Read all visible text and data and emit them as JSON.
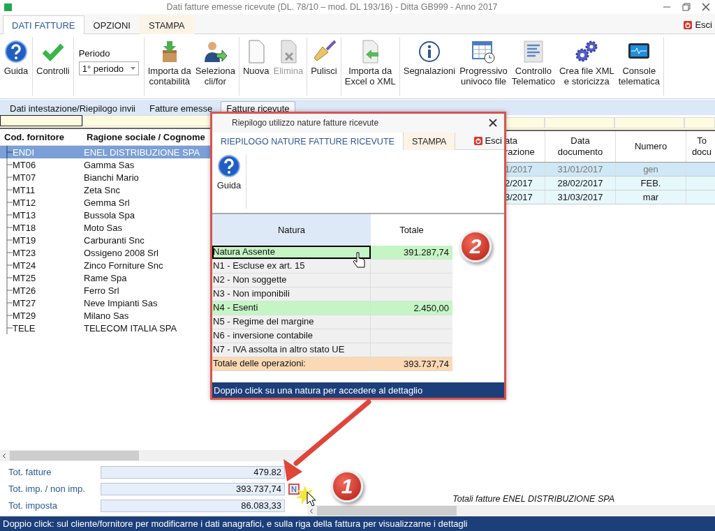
{
  "window": {
    "title": "Dati fatture emesse ricevute (DL. 78/10 – mod. DL 193/16) - Ditta GB999 - Anno 2017"
  },
  "ribbon": {
    "tabs": [
      {
        "label": "DATI FATTURE",
        "selected": true
      },
      {
        "label": "OPZIONI",
        "selected": false
      },
      {
        "label": "STAMPA",
        "selected": false
      }
    ],
    "exit": "Esci"
  },
  "toolbar": [
    [
      {
        "kind": "button",
        "label": "Guida",
        "disabled": false
      }
    ],
    [
      {
        "kind": "button",
        "label": "Controlli",
        "disabled": false
      }
    ],
    [
      {
        "kind": "select",
        "label": "Periodo",
        "value": "1° periodo"
      }
    ],
    [
      {
        "kind": "button",
        "label": "Importa da\ncontabilità",
        "disabled": false
      },
      {
        "kind": "button",
        "label": "Seleziona\ncli/for",
        "disabled": false
      }
    ],
    [
      {
        "kind": "button",
        "label": "Nuova",
        "disabled": false
      },
      {
        "kind": "button",
        "label": "Elimina",
        "disabled": true
      }
    ],
    [
      {
        "kind": "button",
        "label": "Pulisci",
        "disabled": false
      }
    ],
    [
      {
        "kind": "button",
        "label": "Importa da\nExcel o XML",
        "disabled": false
      }
    ],
    [
      {
        "kind": "button",
        "label": "Segnalazioni",
        "disabled": false
      },
      {
        "kind": "button",
        "label": "Progressivo\nunivoco file",
        "disabled": false
      },
      {
        "kind": "button",
        "label": "Controllo\nTelematico",
        "disabled": false
      },
      {
        "kind": "button",
        "label": "Crea file XML\ne storicizza",
        "disabled": false
      },
      {
        "kind": "button",
        "label": "Console\ntelematica",
        "disabled": false
      }
    ]
  ],
  "subtabs": [
    {
      "label": "Dati intestazione/Riepilogo invii",
      "selected": false
    },
    {
      "label": "Fatture emesse",
      "selected": false
    },
    {
      "label": "Fatture ricevute",
      "selected": true
    }
  ],
  "suppliers": {
    "columns": [
      "Cod. fornitore",
      "Ragione sociale / Cognome"
    ],
    "rows": [
      {
        "code": "ENDI",
        "name": "ENEL DISTRIBUZIONE SPA",
        "selected": true
      },
      {
        "code": "MT06",
        "name": "Gamma Sas",
        "selected": false
      },
      {
        "code": "MT07",
        "name": "Bianchi Mario",
        "selected": false
      },
      {
        "code": "MT11",
        "name": "Zeta Snc",
        "selected": false
      },
      {
        "code": "MT12",
        "name": "Gemma Srl",
        "selected": false
      },
      {
        "code": "MT13",
        "name": "Bussola Spa",
        "selected": false
      },
      {
        "code": "MT18",
        "name": "Moto Sas",
        "selected": false
      },
      {
        "code": "MT19",
        "name": "Carburanti Snc",
        "selected": false
      },
      {
        "code": "MT23",
        "name": "Ossigeno 2008 Srl",
        "selected": false
      },
      {
        "code": "MT24",
        "name": "Zinco Forniture Snc",
        "selected": false
      },
      {
        "code": "MT25",
        "name": "Rame Spa",
        "selected": false
      },
      {
        "code": "MT26",
        "name": "Ferro Srl",
        "selected": false
      },
      {
        "code": "MT27",
        "name": "Neve Impianti Sas",
        "selected": false
      },
      {
        "code": "MT29",
        "name": "Milano Sas",
        "selected": false
      },
      {
        "code": "TELE",
        "name": "TELECOM ITALIA SPA",
        "selected": false
      }
    ]
  },
  "totals": [
    {
      "label": "Tot. fatture",
      "value": "479.82"
    },
    {
      "label": "Tot. imp. / non imp.",
      "value": "393.737,74",
      "badge": "N"
    },
    {
      "label": "Tot. imposta",
      "value": "86.083,33"
    }
  ],
  "invoices": {
    "columns": [
      "ata\nrazione",
      "Data\ndocumento",
      "Numero",
      "To\ndocu"
    ],
    "rows": [
      {
        "cells": [
          "1/2017",
          "31/01/2017",
          "gen"
        ],
        "selected": true
      },
      {
        "cells": [
          "2/2017",
          "28/02/2017",
          "FEB."
        ],
        "selected": false
      },
      {
        "cells": [
          "3/2017",
          "31/03/2017",
          "mar"
        ],
        "selected": false
      }
    ],
    "footer": "Totali fatture ENEL DISTRIBUZIONE SPA"
  },
  "status_bar": "Doppio click: sul cliente/fornitore per modificarne i dati anagrafici, e sulla riga della fattura per visualizzarne i dettagli",
  "popup": {
    "title": "Riepilogo utilizzo nature fatture ricevute",
    "tabs": [
      {
        "label": "RIEPILOGO NATURE FATTURE RICEVUTE",
        "selected": true
      },
      {
        "label": "STAMPA",
        "selected": false
      }
    ],
    "exit": "Esci",
    "help": "Guida",
    "columns": [
      "Natura",
      "Totale"
    ],
    "rows": [
      {
        "kind": "used",
        "natura": "Natura Assente",
        "totale": "391.287,74",
        "focused": true
      },
      {
        "kind": "empty",
        "natura": "N1 - Escluse ex art. 15",
        "focused": false
      },
      {
        "kind": "empty",
        "natura": "N2 - Non soggette",
        "focused": false
      },
      {
        "kind": "empty",
        "natura": "N3 - Non imponibili",
        "focused": false
      },
      {
        "kind": "used",
        "natura": "N4 - Esenti",
        "totale": "2.450,00",
        "focused": false
      },
      {
        "kind": "empty",
        "natura": "N5 - Regime del margine",
        "focused": false
      },
      {
        "kind": "empty",
        "natura": "N6 - inversione contabile",
        "focused": false
      },
      {
        "kind": "empty",
        "natura": "N7 - IVA assolta in altro stato UE",
        "focused": false
      },
      {
        "kind": "total",
        "natura": "Totale delle operazioni:",
        "totale": "393.737,74",
        "focused": false
      }
    ],
    "hint": "Doppio click su una natura per accedere al dettaglio"
  },
  "annotations": [
    {
      "label": "1"
    },
    {
      "label": "2"
    }
  ]
}
